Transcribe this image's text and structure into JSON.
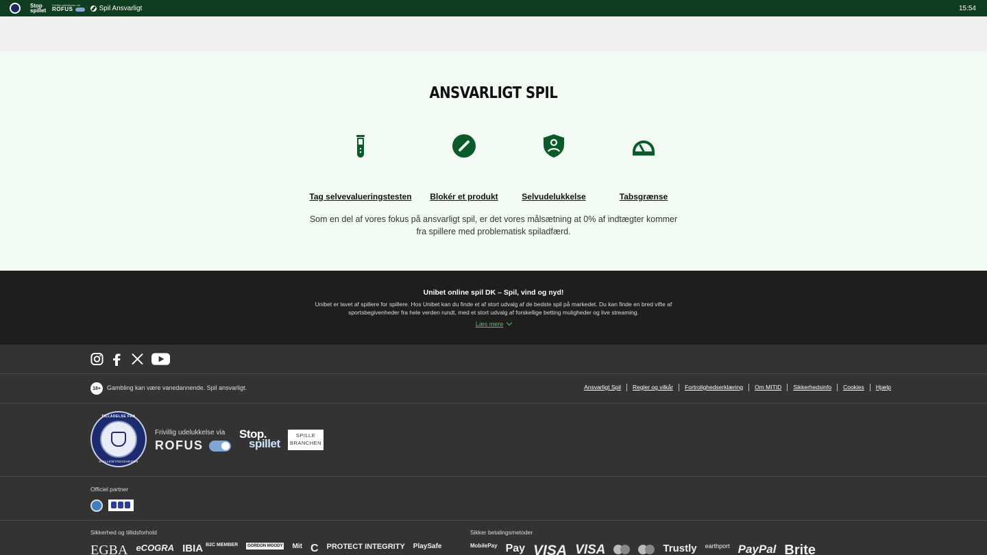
{
  "topbar": {
    "stop_label": "Stop spillet",
    "rofus_small": "Frivillig udelukkelse via",
    "rofus_label": "ROFUS",
    "rg_label": "Spil Ansvarligt",
    "time": "15:54"
  },
  "responsible": {
    "title": "ANSVARLIGT SPIL",
    "items": [
      {
        "label": "Tag selvevalueringstesten",
        "icon": "test-tube-icon"
      },
      {
        "label": "Blokér et produkt",
        "icon": "block-icon"
      },
      {
        "label": "Selvudelukkelse",
        "icon": "shield-person-icon"
      },
      {
        "label": "Tabsgrænse",
        "icon": "gauge-icon"
      }
    ],
    "text": "Som en del af vores fokus på ansvarligt spil, er det vores målsætning at 0% af indtægter kommer fra spillere med problematisk spiladfærd."
  },
  "info": {
    "title": "Unibet online spil DK – Spil, vind og nyd!",
    "text": "Unibet er lavet af spillere for spillere. Hos Unibet kan du finde et af stort udvalg af de bedste spil på markedet. Du kan finde en bred vifte af sportsbegivenheder fra hele verden rundt, med et stort udvalg af forskellige betting muligheder og live streaming.",
    "more": "Læs mere"
  },
  "legal": {
    "age": "18+",
    "warning": "Gambling kan være vanedannende. Spil ansvarligt.",
    "links": [
      "Ansvarligt Spil",
      "Regler og vilkår",
      "Fortrolighedserklæring",
      "Om MITID",
      "Sikkerhedsinfo",
      "Cookies",
      "Hjælp"
    ]
  },
  "logos": {
    "seal_top": "TILLADELSE FRA",
    "seal_bottom": "SPILLEMYNDIGHEDEN",
    "rofus_small": "Frivillig udelukkelse via",
    "rofus_big": "ROFUS",
    "stop_a": "Stop.",
    "stop_b": "spillet",
    "branchen": "SPILLE BRANCHEN"
  },
  "partner": {
    "label": "Officiel partner"
  },
  "bottom": {
    "security_label": "Sikkerhed og tillidsforhold",
    "security_logos": [
      "EGBA",
      "eCOGRA",
      "IBIA",
      "B2C MEMBER",
      "GORDON MOODY",
      "Mit",
      "C",
      "PROTECT INTEGRITY",
      "PlaySafe"
    ],
    "payment_label": "Sikker betalingsmetoder",
    "payment_logos": [
      "MobilePay",
      "Pay",
      "VISA",
      "VISA",
      "Trustly",
      "earthport",
      "PayPal",
      "Brite"
    ]
  }
}
